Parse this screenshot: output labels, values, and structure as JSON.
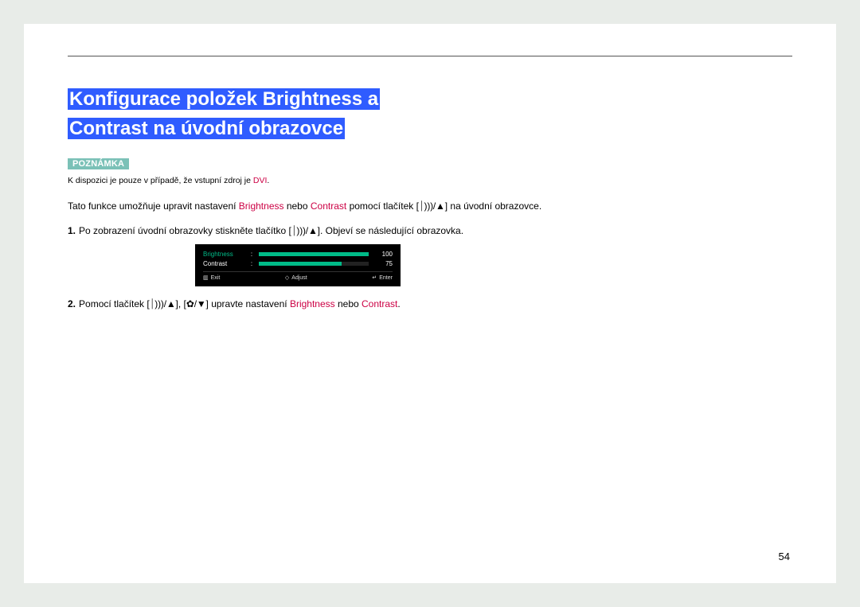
{
  "heading": {
    "line1": "Konfigurace položek Brightness a",
    "line2": "Contrast na úvodní obrazovce"
  },
  "note": {
    "badge": "POZNÁMKA",
    "text_before": "K dispozici je pouze v případě, že vstupní zdroj je ",
    "dvi": "DVI",
    "text_after": "."
  },
  "intro": {
    "t1": "Tato funkce umožňuje upravit nastavení ",
    "term_brightness": "Brightness",
    "t2": " nebo ",
    "term_contrast": "Contrast",
    "t3": " pomocí tlačítek [",
    "btn1": "⏐︎)))/▲",
    "t4": "] na úvodní obrazovce."
  },
  "steps": {
    "s1_num": "1.",
    "s1_a": "Po zobrazení úvodní obrazovky stiskněte tlačítko [",
    "s1_btn": "⏐︎)))/▲",
    "s1_b": "]. Objeví se následující obrazovka.",
    "s2_num": "2.",
    "s2_a": "Pomocí tlačítek [",
    "s2_btn1": "⏐︎)))/▲",
    "s2_b": "], [",
    "s2_btn2": "✿/▼",
    "s2_c": "] upravte nastavení ",
    "s2_term1": "Brightness",
    "s2_d": " nebo ",
    "s2_term2": "Contrast",
    "s2_e": "."
  },
  "osd": {
    "row1_label": "Brightness",
    "row1_value": "100",
    "row1_pct": 100,
    "row2_label": "Contrast",
    "row2_value": "75",
    "row2_pct": 75,
    "exit": "Exit",
    "adjust": "Adjust",
    "enter": "Enter"
  },
  "page_number": "54"
}
